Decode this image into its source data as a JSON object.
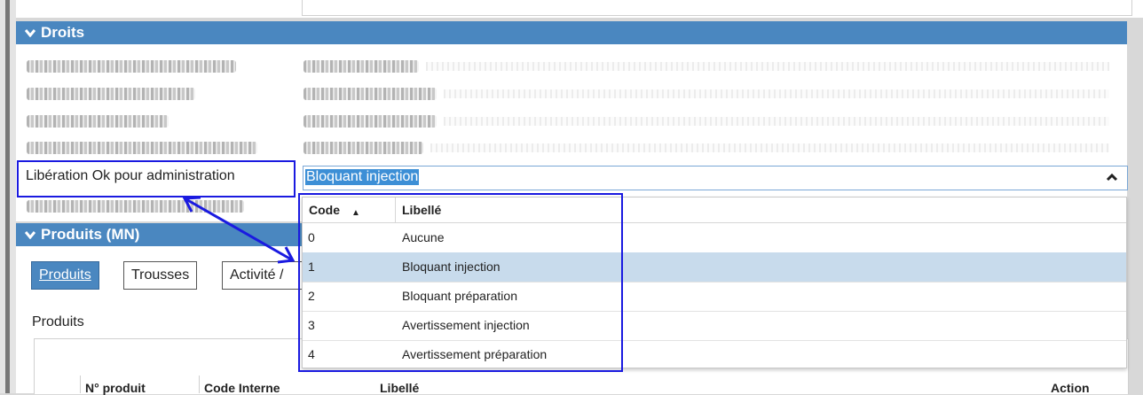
{
  "droits_panel": {
    "title": "Droits"
  },
  "liberation_field": {
    "label": "Libération Ok pour administration",
    "selected_value": "Bloquant injection"
  },
  "dropdown": {
    "columns": [
      "Code",
      "Libellé"
    ],
    "rows": [
      {
        "code": "0",
        "label": "Aucune"
      },
      {
        "code": "1",
        "label": "Bloquant injection"
      },
      {
        "code": "2",
        "label": "Bloquant préparation"
      },
      {
        "code": "3",
        "label": "Avertissement injection"
      },
      {
        "code": "4",
        "label": "Avertissement préparation"
      }
    ],
    "selected_code": "1"
  },
  "produits_panel": {
    "title": "Produits (MN)",
    "tabs": [
      "Produits",
      "Trousses",
      "Activité /"
    ],
    "section_title": "Produits",
    "table_headers": [
      "N° produit",
      "Code Interne",
      "Libellé",
      "Action"
    ]
  },
  "colors": {
    "header": "#4a87c0",
    "selection": "#3d8fd6",
    "selected_row": "#c8dbec",
    "annotation": "#1a1ae0"
  }
}
